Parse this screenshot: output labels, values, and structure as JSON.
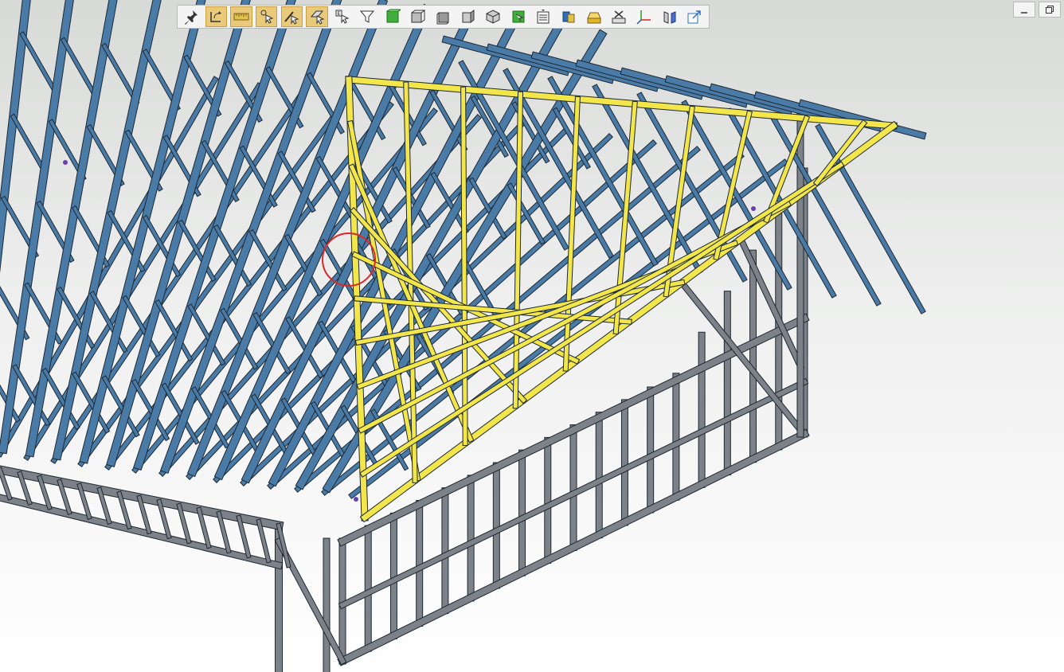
{
  "toolbar": {
    "tools": [
      {
        "name": "pin-icon",
        "active": false
      },
      {
        "name": "rotate-view-icon",
        "active": true
      },
      {
        "name": "measure-ruler-icon",
        "active": true
      },
      {
        "name": "select-point-icon",
        "active": true
      },
      {
        "name": "select-edge-icon",
        "active": true
      },
      {
        "name": "select-face-icon",
        "active": true
      },
      {
        "name": "select-body-icon",
        "active": false
      },
      {
        "name": "filter-icon",
        "active": false
      },
      {
        "name": "solid-view-icon",
        "active": false
      },
      {
        "name": "front-view-icon",
        "active": false
      },
      {
        "name": "back-view-icon",
        "active": false
      },
      {
        "name": "side-view-icon",
        "active": false
      },
      {
        "name": "isometric-view-icon",
        "active": false
      },
      {
        "name": "zoom-fit-icon",
        "active": false
      },
      {
        "name": "list-icon",
        "active": false
      },
      {
        "name": "explode-icon",
        "active": false
      },
      {
        "name": "section-icon",
        "active": false
      },
      {
        "name": "hide-icon",
        "active": false
      },
      {
        "name": "axes-icon",
        "active": false
      },
      {
        "name": "mirror-icon",
        "active": false
      },
      {
        "name": "export-icon",
        "active": false
      }
    ]
  },
  "colors": {
    "truss_blue": "#4a7ba7",
    "highlight_yellow": "#f2e64a",
    "steel_gray": "#7d8289",
    "selection_circle": "#d82a2a"
  }
}
